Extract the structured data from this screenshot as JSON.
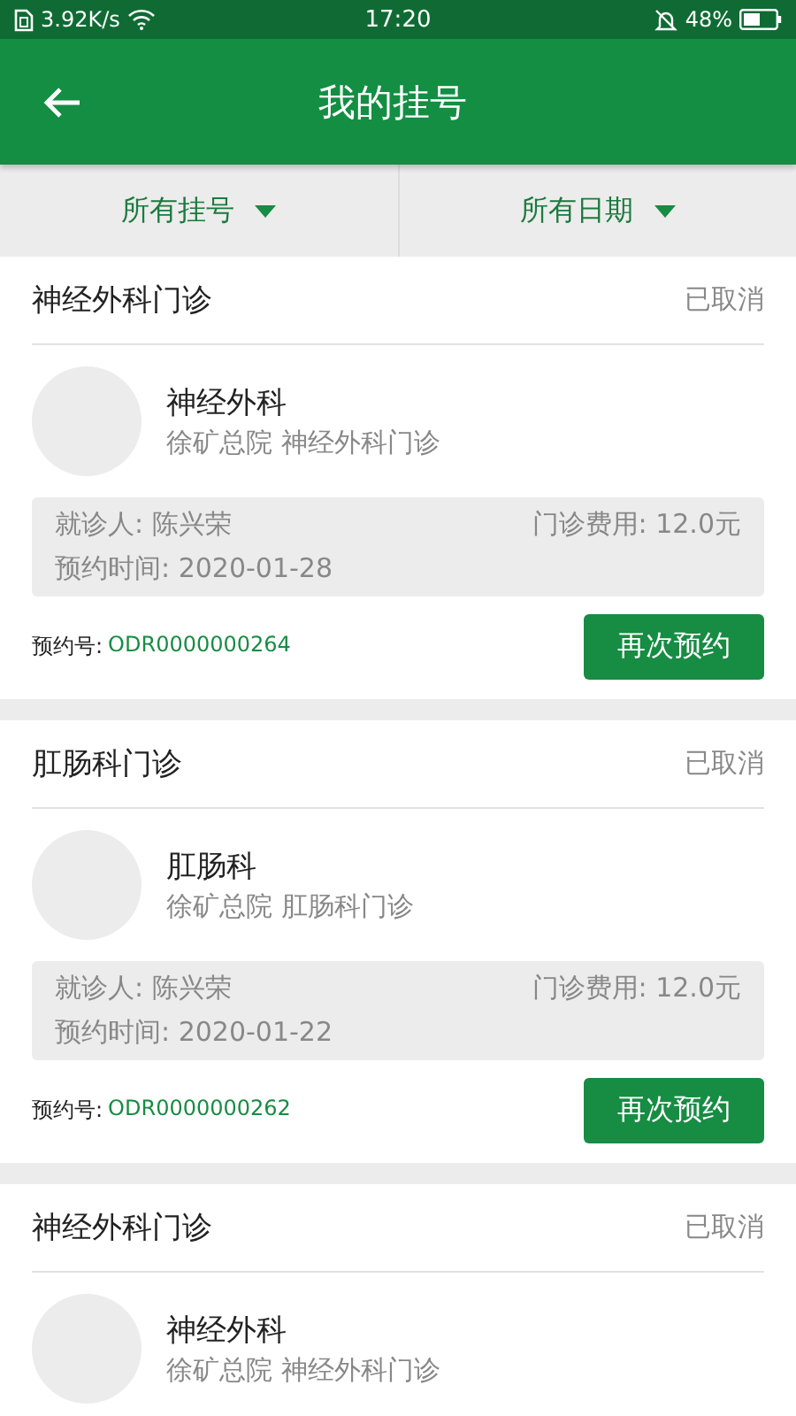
{
  "status_bar": {
    "speed": "3.92K/s",
    "time": "17:20",
    "battery": "48%"
  },
  "header": {
    "title": "我的挂号"
  },
  "filters": [
    {
      "label": "所有挂号"
    },
    {
      "label": "所有日期"
    }
  ],
  "appointments": [
    {
      "clinic": "神经外科门诊",
      "status": "已取消",
      "department": "神经外科",
      "hospital": "徐矿总院 神经外科门诊",
      "patient": "就诊人: 陈兴荣",
      "fee": "门诊费用: 12.0元",
      "date": "预约时间: 2020-01-28",
      "order_label": "预约号:",
      "order_no": "ODR0000000264",
      "action": "再次预约"
    },
    {
      "clinic": "肛肠科门诊",
      "status": "已取消",
      "department": "肛肠科",
      "hospital": "徐矿总院 肛肠科门诊",
      "patient": "就诊人: 陈兴荣",
      "fee": "门诊费用: 12.0元",
      "date": "预约时间: 2020-01-22",
      "order_label": "预约号:",
      "order_no": "ODR0000000262",
      "action": "再次预约"
    },
    {
      "clinic": "神经外科门诊",
      "status": "已取消",
      "department": "神经外科",
      "hospital": "徐矿总院 神经外科门诊"
    }
  ]
}
